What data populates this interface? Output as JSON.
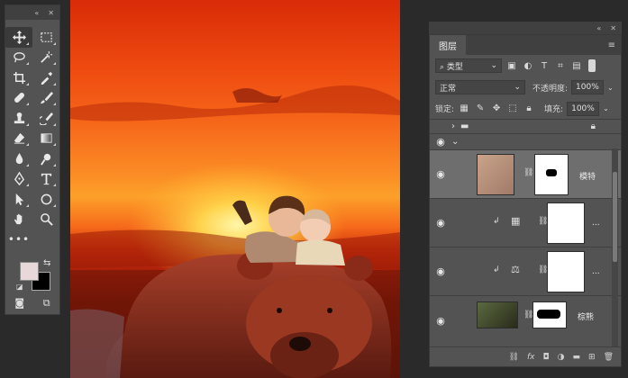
{
  "tools_panel": {
    "collapse_label": "«",
    "close_label": "✕",
    "more_label": "•••"
  },
  "layers_panel": {
    "tab_label": "图层",
    "panel_collapse_label": "«",
    "panel_close_label": "✕",
    "menu_label": "≡",
    "filter": {
      "label": "类型",
      "icons": [
        "image-filter-icon",
        "adjustment-filter-icon",
        "text-filter-icon",
        "shape-filter-icon",
        "smart-object-filter-icon"
      ]
    },
    "blend_mode": "正常",
    "opacity_label": "不透明度:",
    "opacity_value": "100%",
    "lock_label": "锁定:",
    "fill_label": "填充:",
    "fill_value": "100%",
    "layers": [
      {
        "name": "模特",
        "type": "smart-object-with-mask",
        "visible": true,
        "selected": true
      },
      {
        "name": "...",
        "type": "adjustment-color-balance",
        "visible": true,
        "clipped": true
      },
      {
        "name": "...",
        "type": "adjustment-levels",
        "visible": true,
        "clipped": true
      },
      {
        "name": "棕熊",
        "type": "smart-object-with-mask",
        "visible": true
      }
    ],
    "footer_icons": [
      "link-icon",
      "fx-icon",
      "add-mask-icon",
      "new-adjustment-icon",
      "new-group-icon",
      "new-layer-icon",
      "delete-icon"
    ],
    "fx_label": "fx"
  },
  "colors": {
    "foreground": "#e8d8da",
    "background": "#000000",
    "panel": "#535353",
    "selected_layer": "#6e6e6e"
  }
}
